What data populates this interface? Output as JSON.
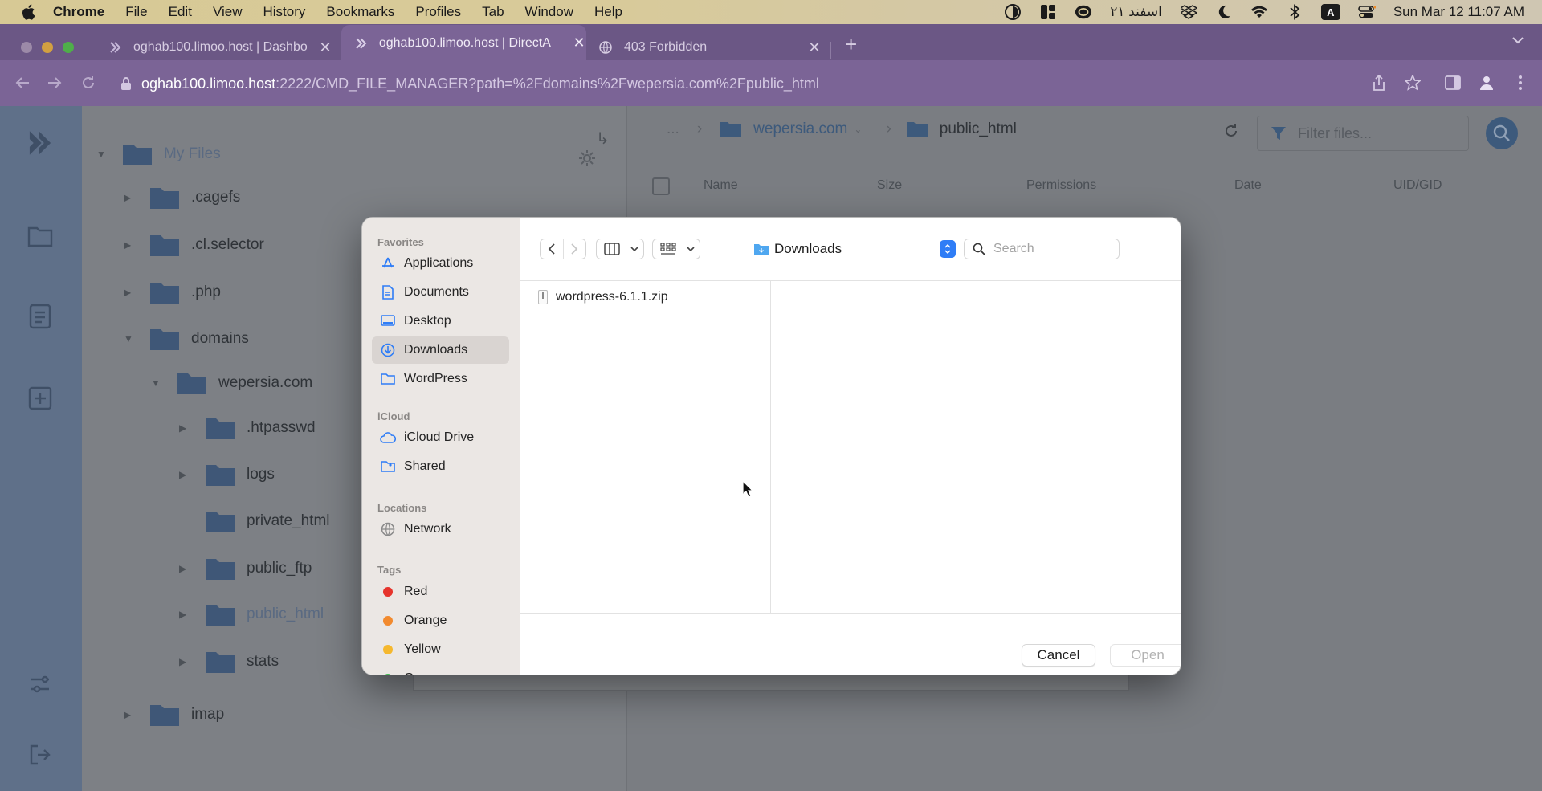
{
  "menubar": {
    "app": "Chrome",
    "items": [
      "File",
      "Edit",
      "View",
      "History",
      "Bookmarks",
      "Profiles",
      "Tab",
      "Window",
      "Help"
    ],
    "persian_date": "۲۱ اسفند",
    "input_source": "A",
    "clock": "Sun Mar 12  11:07 AM"
  },
  "browser": {
    "tabs": [
      {
        "title": "oghab100.limoo.host | Dashbo",
        "active": false
      },
      {
        "title": "oghab100.limoo.host | DirectA",
        "active": true
      },
      {
        "title": "403 Forbidden",
        "active": false
      }
    ],
    "new_tab": "+",
    "url_host": "oghab100.limoo.host",
    "url_rest": ":2222/CMD_FILE_MANAGER?path=%2Fdomains%2Fwepersia.com%2Fpublic_html"
  },
  "file_manager": {
    "tree": [
      {
        "label": "My Files",
        "muted": true,
        "caret": "▼"
      },
      {
        "label": ".cagefs",
        "caret": "▶"
      },
      {
        "label": ".cl.selector",
        "caret": "▶"
      },
      {
        "label": ".php",
        "caret": "▶"
      },
      {
        "label": "domains",
        "caret": "▼"
      },
      {
        "label": "wepersia.com",
        "caret": "▼"
      },
      {
        "label": ".htpasswd",
        "caret": "▶"
      },
      {
        "label": "logs",
        "caret": "▶"
      },
      {
        "label": "private_html",
        "caret": ""
      },
      {
        "label": "public_ftp",
        "caret": "▶"
      },
      {
        "label": "public_html",
        "muted": true,
        "caret": "▶"
      },
      {
        "label": "stats",
        "caret": "▶"
      },
      {
        "label": "imap",
        "caret": "▶"
      }
    ],
    "breadcrumb": [
      "...",
      "wepersia.com",
      "public_html"
    ],
    "filter_placeholder": "Filter files...",
    "columns": [
      "Name",
      "Size",
      "Permissions",
      "Date",
      "UID/GID"
    ]
  },
  "dialog": {
    "sidebar": {
      "favorites_heading": "Favorites",
      "favorites": [
        {
          "label": "Applications",
          "icon": "applications-icon"
        },
        {
          "label": "Documents",
          "icon": "document-icon"
        },
        {
          "label": "Desktop",
          "icon": "desktop-icon"
        },
        {
          "label": "Downloads",
          "icon": "downloads-icon",
          "selected": true
        },
        {
          "label": "WordPress",
          "icon": "folder-icon"
        }
      ],
      "icloud_heading": "iCloud",
      "icloud": [
        {
          "label": "iCloud Drive",
          "icon": "cloud-icon"
        },
        {
          "label": "Shared",
          "icon": "shared-folder-icon"
        }
      ],
      "locations_heading": "Locations",
      "locations": [
        {
          "label": "Network",
          "icon": "globe-icon"
        }
      ],
      "tags_heading": "Tags",
      "tags": [
        {
          "label": "Red",
          "color": "#e6342c"
        },
        {
          "label": "Orange",
          "color": "#f28a2e"
        },
        {
          "label": "Yellow",
          "color": "#f5b82e"
        },
        {
          "label": "Green",
          "color": "#3dba4e"
        }
      ]
    },
    "location": "Downloads",
    "search_placeholder": "Search",
    "files": [
      "wordpress-6.1.1.zip"
    ],
    "cancel_label": "Cancel",
    "open_label": "Open"
  }
}
